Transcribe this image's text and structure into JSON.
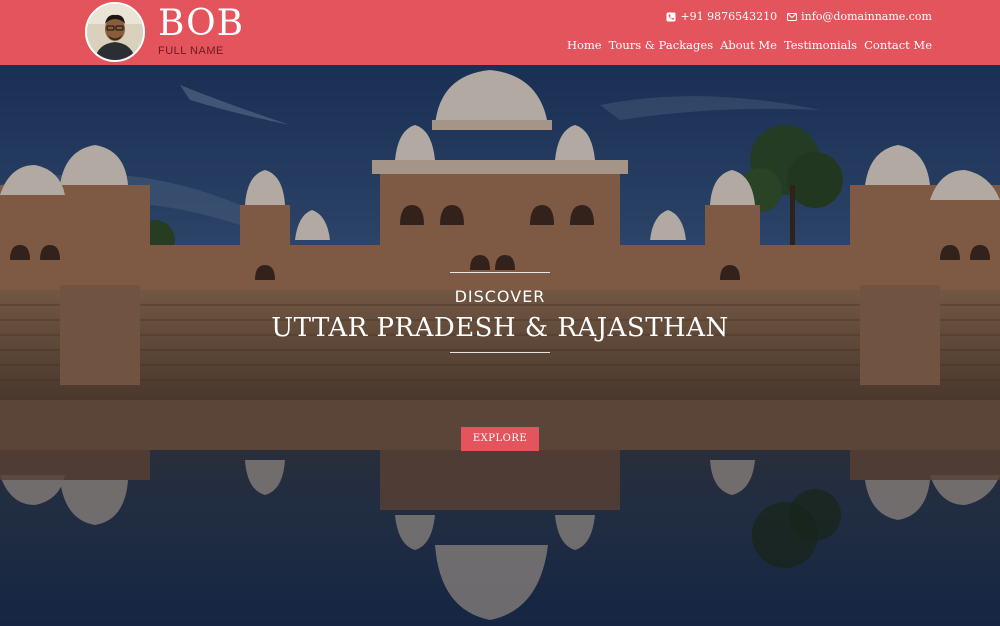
{
  "header": {
    "brand_name": "BOB",
    "brand_subtitle": "FULL NAME",
    "avatar_icon": "person-avatar",
    "phone": "+91 9876543210",
    "email": "info@domainname.com",
    "phone_icon": "phone-icon",
    "email_icon": "envelope-icon",
    "nav": [
      "Home",
      "Tours & Packages",
      "About Me",
      "Testimonials",
      "Contact Me"
    ]
  },
  "hero": {
    "eyebrow": "DISCOVER",
    "title": "UTTAR PRADESH & RAJASTHAN",
    "cta_label": "EXPLORE"
  },
  "colors": {
    "accent": "#e4545d",
    "sky": "#24406a",
    "sandstone": "#9a6a4a"
  }
}
